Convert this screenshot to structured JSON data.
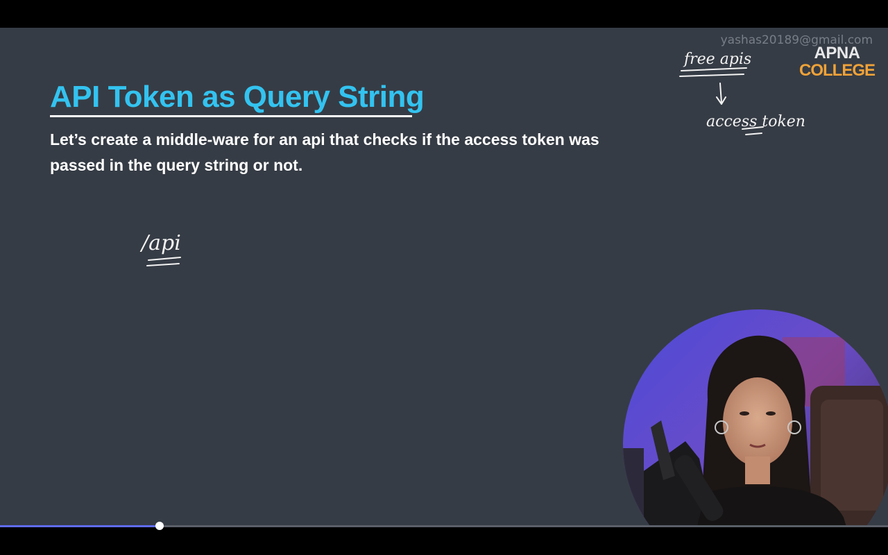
{
  "slide": {
    "title": "API Token as Query String",
    "subtitle": "Let’s create a middle-ware for an api that checks if the access token was passed in the query string or not.",
    "watermark": "yashas20189@gmail.com",
    "logo": {
      "line1": "APNA",
      "line2": "COLLEGE"
    }
  },
  "annotations": {
    "top_right_1": "free apis",
    "top_right_2": "access token",
    "left": "/api"
  },
  "player": {
    "progress_fraction": 0.18
  },
  "colors": {
    "slide_bg": "#363c45",
    "title": "#33c3f0",
    "logo_accent": "#f0a238",
    "progress": "#5f6cf2"
  }
}
